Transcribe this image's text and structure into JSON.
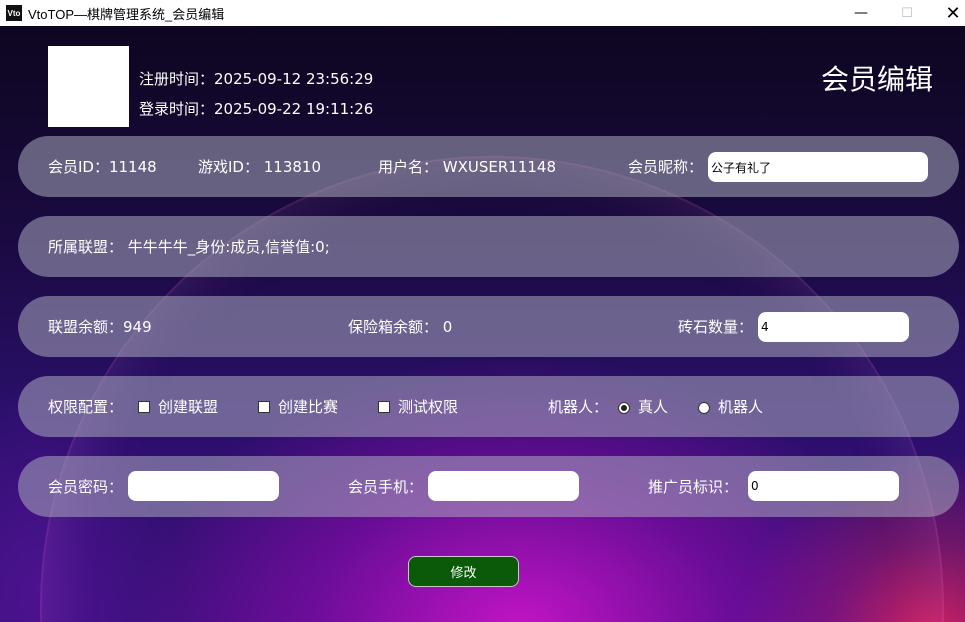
{
  "window": {
    "logo_text": "Vto",
    "title": "VtoTOP—棋牌管理系统_会员编辑",
    "min_glyph": "—",
    "max_glyph": "☐",
    "close_glyph": "✕"
  },
  "header": {
    "register_time": "注册时间：2025-09-12 23:56:29",
    "login_time": "登录时间：2025-09-22 19:11:26",
    "page_title": "会员编辑"
  },
  "row1": {
    "member_id": "会员ID：11148",
    "game_id": "游戏ID： 113810",
    "username": "用户名： WXUSER11148",
    "nickname_label": "会员昵称：",
    "nickname_value": "公子有礼了"
  },
  "row2": {
    "alliance": "所属联盟： 牛牛牛牛_身份:成员,信誉值:0;"
  },
  "row3": {
    "alliance_balance": "联盟余额：949",
    "safe_balance": "保险箱余额： 0",
    "diamond_label": "砖石数量：",
    "diamond_value": "4"
  },
  "row4": {
    "perm_label": "权限配置：",
    "perm_create_alliance": "创建联盟",
    "perm_create_match": "创建比赛",
    "perm_test": "测试权限",
    "robot_label": "机器人：",
    "radio_human": "真人",
    "radio_robot": "机器人"
  },
  "row5": {
    "password_label": "会员密码：",
    "password_value": "",
    "phone_label": "会员手机：",
    "phone_value": "",
    "promoter_label": "推广员标识：",
    "promoter_value": "0"
  },
  "actions": {
    "submit_label": "修改"
  },
  "colors": {
    "submit_bg": "#0a5a0a",
    "panel_bg": "rgba(170,170,190,0.55)",
    "text": "#ffffff"
  }
}
